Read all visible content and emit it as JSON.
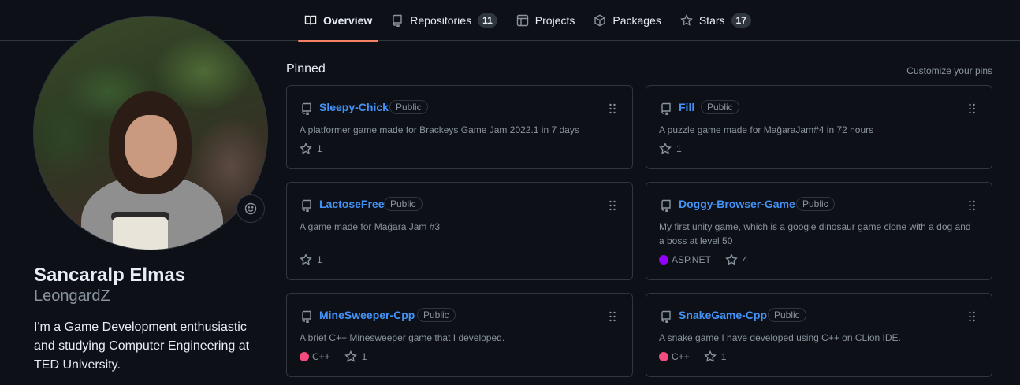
{
  "nav": {
    "tabs": [
      {
        "label": "Overview",
        "icon": "book-icon",
        "active": true
      },
      {
        "label": "Repositories",
        "icon": "repo-icon",
        "count": "11"
      },
      {
        "label": "Projects",
        "icon": "table-icon"
      },
      {
        "label": "Packages",
        "icon": "package-icon"
      },
      {
        "label": "Stars",
        "icon": "star-icon",
        "count": "17"
      }
    ]
  },
  "profile": {
    "name": "Sancaralp Elmas",
    "login": "LeongardZ",
    "bio": "I'm a Game Development enthusiastic and studying Computer Engineering at TED University."
  },
  "pinned": {
    "title": "Pinned",
    "customize_label": "Customize your pins",
    "repos": [
      {
        "name": "Sleepy-Chick",
        "visibility": "Public",
        "description": "A platformer game made for Brackeys Game Jam 2022.1 in 7 days",
        "language": "",
        "language_color": "",
        "stars": "1"
      },
      {
        "name": "Fill",
        "visibility": "Public",
        "description": "A puzzle game made for MağaraJam#4 in 72 hours",
        "language": "",
        "language_color": "",
        "stars": "1"
      },
      {
        "name": "LactoseFree",
        "visibility": "Public",
        "description": "A game made for Mağara Jam #3",
        "language": "",
        "language_color": "",
        "stars": "1"
      },
      {
        "name": "Doggy-Browser-Game",
        "visibility": "Public",
        "description": "My first unity game, which is a google dinosaur game clone with a dog and a boss at level 50",
        "language": "ASP.NET",
        "language_color": "#9400ff",
        "stars": "4"
      },
      {
        "name": "MineSweeper-Cpp",
        "visibility": "Public",
        "description": "A brief C++ Minesweeper game that I developed.",
        "language": "C++",
        "language_color": "#f34b7d",
        "stars": "1"
      },
      {
        "name": "SnakeGame-Cpp",
        "visibility": "Public",
        "description": "A snake game I have developed using C++ on CLion IDE.",
        "language": "C++",
        "language_color": "#f34b7d",
        "stars": "1"
      }
    ]
  },
  "colors": {
    "accent": "#f78166",
    "link": "#4493f8",
    "background": "#0d1117",
    "border": "#30363d"
  }
}
